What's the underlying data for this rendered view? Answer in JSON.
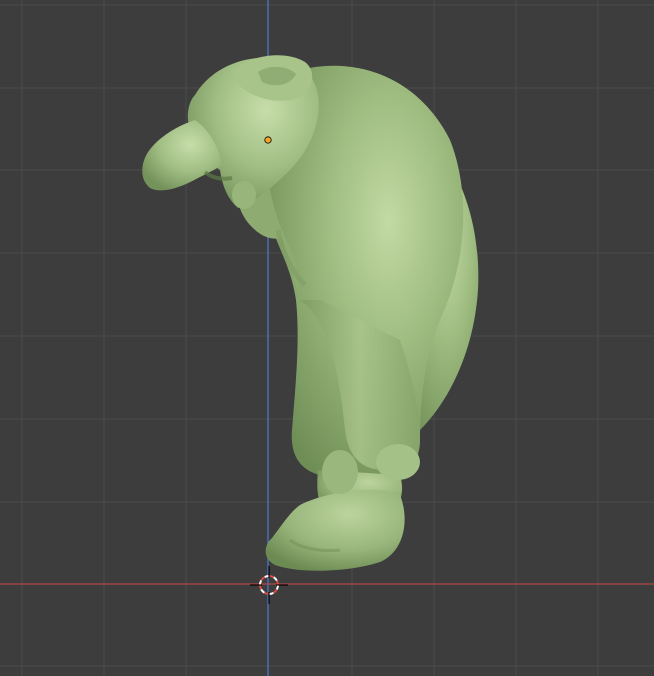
{
  "viewport": {
    "background_color": "#3d3d3d",
    "grid_color": "#4c4c4c",
    "x_axis_color": "#b04848",
    "z_axis_color": "#4a78c8"
  },
  "model": {
    "material_color": "#9dbb7f",
    "highlight_color": "#c2d9a4",
    "shadow_color": "#6f8e56",
    "origin_color": "#f5a623"
  },
  "cursor": {
    "icon": "3d-cursor-icon",
    "ring_colors": [
      "#d94a4a",
      "#ffffff"
    ]
  }
}
